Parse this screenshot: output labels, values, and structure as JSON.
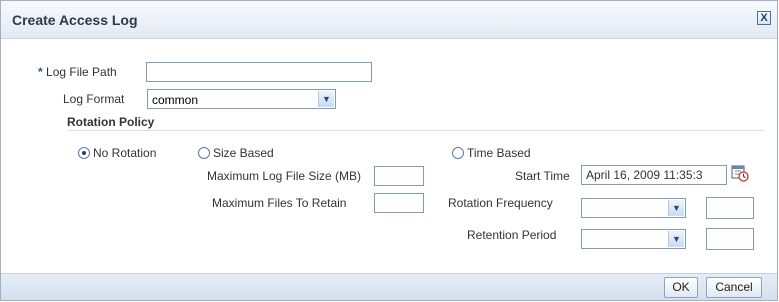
{
  "dialog": {
    "title": "Create Access Log",
    "close_label": "X"
  },
  "form": {
    "log_file_path": {
      "required_marker": "*",
      "label": "Log File Path",
      "value": ""
    },
    "log_format": {
      "label": "Log Format",
      "value": "common"
    },
    "rotation_policy": {
      "title": "Rotation Policy",
      "selected": "No Rotation",
      "options": [
        "No Rotation",
        "Size Based",
        "Time Based"
      ],
      "size_based": {
        "max_log_file_size_label": "Maximum Log File Size (MB)",
        "max_log_file_size_value": "",
        "max_files_to_retain_label": "Maximum Files To Retain",
        "max_files_to_retain_value": ""
      },
      "time_based": {
        "start_time_label": "Start Time",
        "start_time_value": "April 16, 2009 11:35:3",
        "rotation_frequency_label": "Rotation Frequency",
        "rotation_frequency_value": "",
        "rotation_frequency_count": "",
        "retention_period_label": "Retention Period",
        "retention_period_value": "",
        "retention_period_count": ""
      }
    }
  },
  "footer": {
    "ok_label": "OK",
    "cancel_label": "Cancel"
  },
  "icons": {
    "close": "close-icon",
    "calendar": "calendar-clock-icon",
    "dropdown": "chevron-down-icon"
  },
  "colors": {
    "title_text": "#2b3a4f",
    "required_marker": "#2a55a5",
    "header_bg": "#e3eaf3",
    "footer_bg": "#d5e0ee",
    "field_border": "#7f9db9"
  }
}
